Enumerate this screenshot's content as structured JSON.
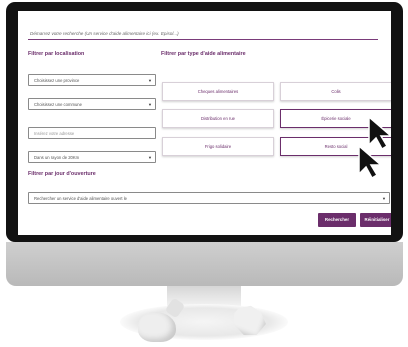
{
  "search": {
    "placeholder": "Démarrez votre recherche (Un service d'aide alimentaire ici (ex. Episol...)"
  },
  "location_filter": {
    "title": "Filtrer par localisation",
    "province_select": "Choisissez une province",
    "commune_select": "Choisissez une commune",
    "address_placeholder": "Insérez votre adresse",
    "radius_select": "Dans un rayon de 20Km"
  },
  "type_filter": {
    "title": "Filtrer par type d'aide alimentaire",
    "options": [
      "Cheques alimentaires",
      "Colis",
      "Distribution en rue",
      "Épicerie sociale",
      "Frigo solidaire",
      "Resto social"
    ]
  },
  "day_filter": {
    "title": "Filtrer par jour d'ouverture",
    "select": "Rechercher un service d'aide alimentaire ouvert le"
  },
  "actions": {
    "search": "Rechercher",
    "reset": "Réinitialiser"
  },
  "colors": {
    "brand": "#6b2e6b",
    "monitor": "#121212"
  }
}
